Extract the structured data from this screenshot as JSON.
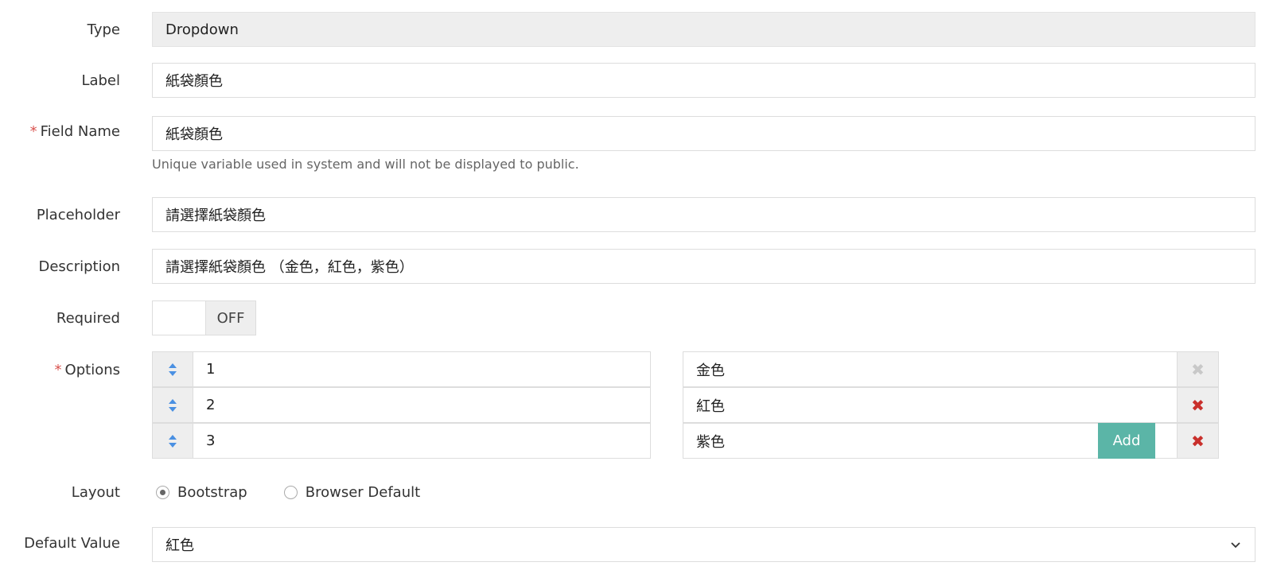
{
  "form": {
    "type": {
      "label": "Type",
      "value": "Dropdown"
    },
    "label_field": {
      "label": "Label",
      "value": "紙袋顏色"
    },
    "field_name": {
      "required_mark": "*",
      "label": "Field Name",
      "value": "紙袋顏色",
      "help": "Unique variable used in system and will not be displayed to public."
    },
    "placeholder": {
      "label": "Placeholder",
      "value": "請選擇紙袋顏色"
    },
    "description": {
      "label": "Description",
      "value": "請選擇紙袋顏色 （金色，紅色，紫色）"
    },
    "required": {
      "label": "Required",
      "state": "OFF"
    },
    "options": {
      "required_mark": "*",
      "label": "Options",
      "rows": [
        {
          "value": "1",
          "label": "金色",
          "delete_enabled": false
        },
        {
          "value": "2",
          "label": "紅色",
          "delete_enabled": true
        },
        {
          "value": "3",
          "label": "紫色",
          "delete_enabled": true
        }
      ],
      "add_label": "Add"
    },
    "layout": {
      "label": "Layout",
      "choices": [
        {
          "label": "Bootstrap",
          "selected": true
        },
        {
          "label": "Browser Default",
          "selected": false
        }
      ]
    },
    "default_value": {
      "label": "Default Value",
      "value": "紅色"
    }
  },
  "icons": {
    "sort_handle": "sort-handle-icon",
    "delete": "close-icon",
    "chevron": "chevron-down-icon"
  },
  "colors": {
    "accent": "#5bb5a7",
    "required_mark": "#d9534f",
    "delete_active": "#c9302c",
    "sort_icon": "#4a90e2"
  }
}
